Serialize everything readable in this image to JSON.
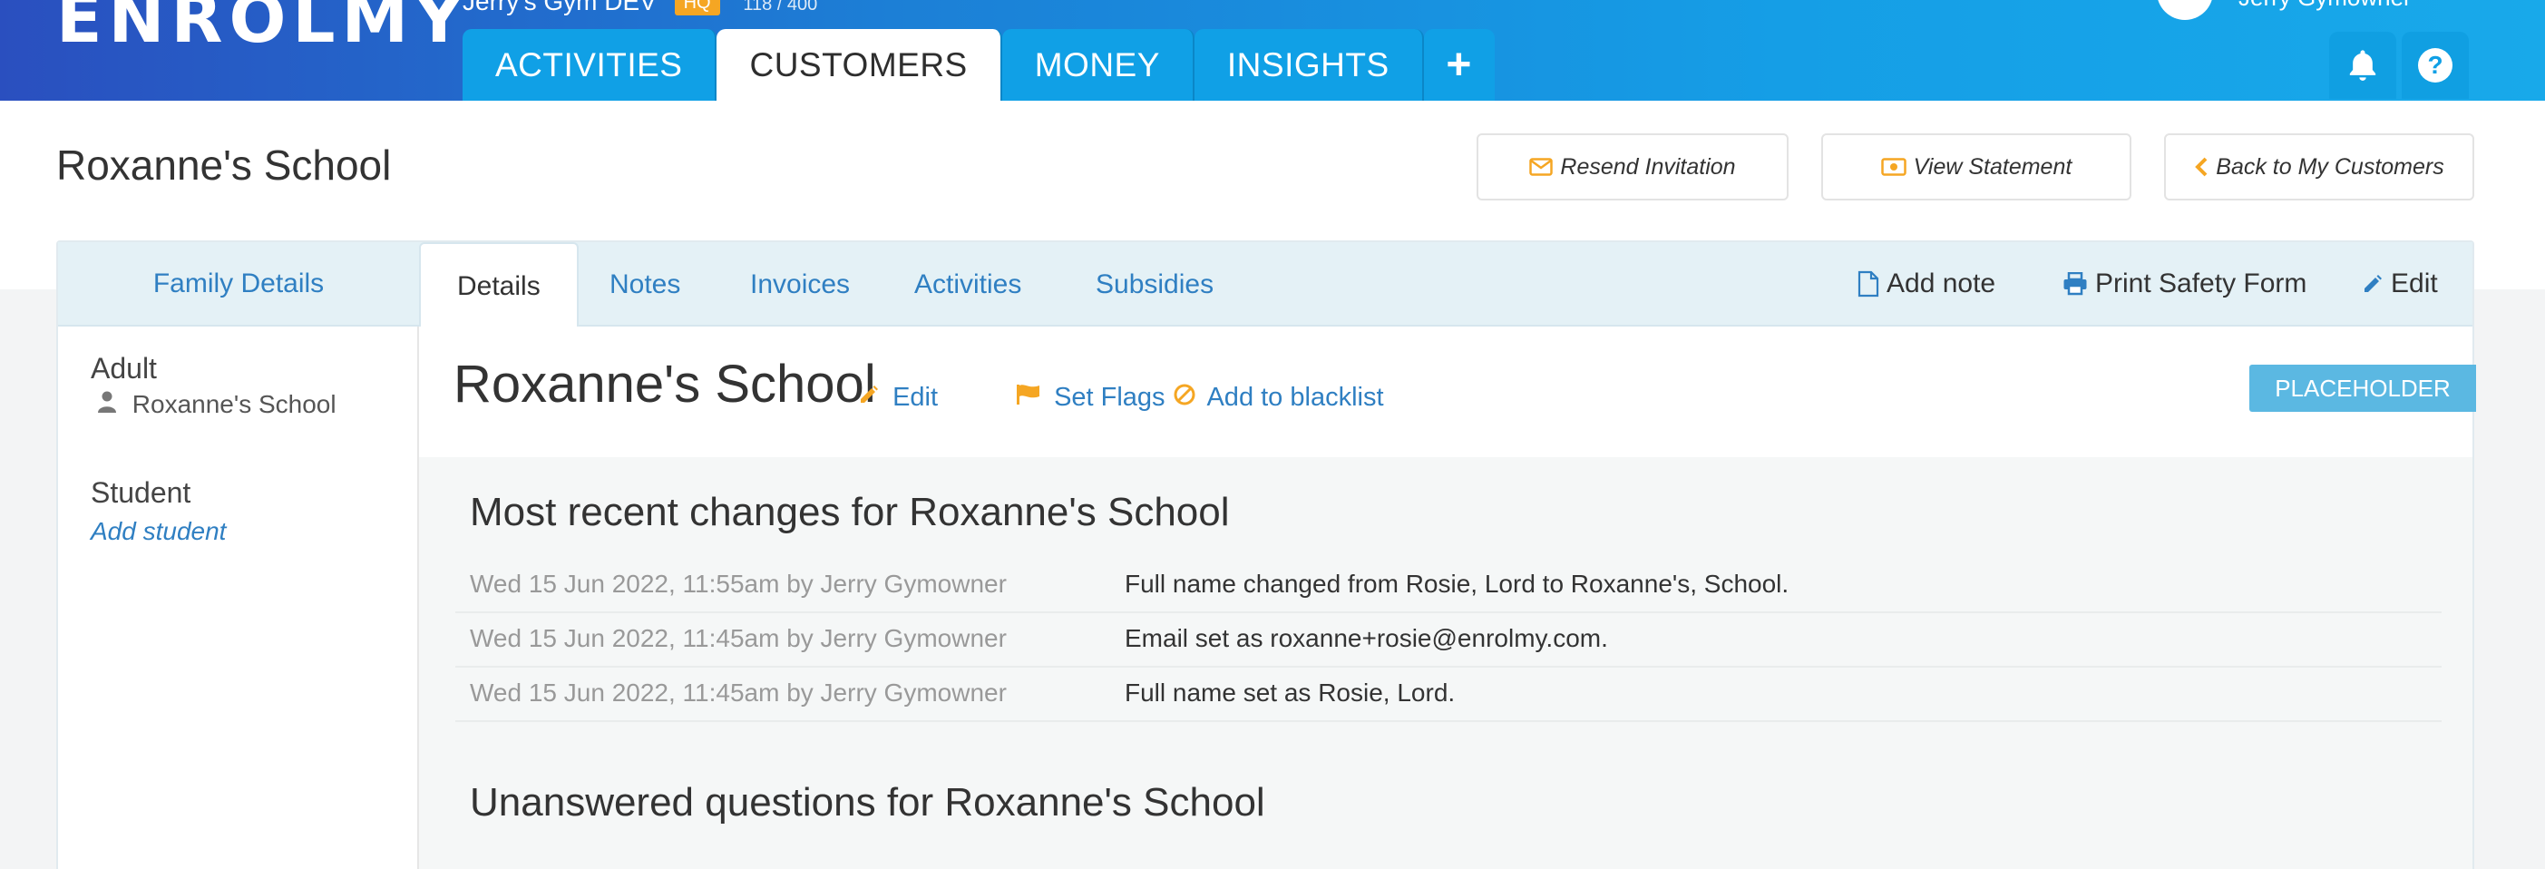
{
  "header": {
    "logo": "ENROLMY",
    "org_name": "Jerry's Gym DEV",
    "org_badge": "HQ",
    "org_count": "118 / 400",
    "user_name": "Jerry Gymowner",
    "nav": [
      "ACTIVITIES",
      "CUSTOMERS",
      "MONEY",
      "INSIGHTS",
      "+"
    ],
    "help_label": "?"
  },
  "page": {
    "title": "Roxanne's School",
    "resend_label": "Resend Invitation",
    "statement_label": "View Statement",
    "back_label": "Back to My Customers"
  },
  "tabs": {
    "family": "Family Details",
    "items": [
      "Details",
      "Notes",
      "Invoices",
      "Activities",
      "Subsidies"
    ],
    "add_note": "Add note",
    "print_safety": "Print Safety Form",
    "edit": "Edit"
  },
  "sidebar": {
    "adult_label": "Adult",
    "adult_name": "Roxanne's School",
    "student_label": "Student",
    "add_student": "Add student"
  },
  "profile": {
    "name": "Roxanne's School",
    "edit": "Edit",
    "set_flags": "Set Flags",
    "blacklist": "Add to blacklist",
    "placeholder": "PLACEHOLDER"
  },
  "changes": {
    "title": "Most recent changes for Roxanne's School",
    "rows": [
      {
        "when": "Wed 15 Jun 2022, 11:55am by Jerry Gymowner",
        "what": "Full name changed from Rosie, Lord to Roxanne's, School."
      },
      {
        "when": "Wed 15 Jun 2022, 11:45am by Jerry Gymowner",
        "what": "Email set as roxanne+rosie@enrolmy.com."
      },
      {
        "when": "Wed 15 Jun 2022, 11:45am by Jerry Gymowner",
        "what": "Full name set as Rosie, Lord."
      }
    ],
    "unanswered_title": "Unanswered questions for Roxanne's School"
  },
  "colors": {
    "link": "#2f7fc2",
    "accent": "#f5a623",
    "header_start": "#2a4fbf",
    "header_end": "#18a9ea"
  }
}
